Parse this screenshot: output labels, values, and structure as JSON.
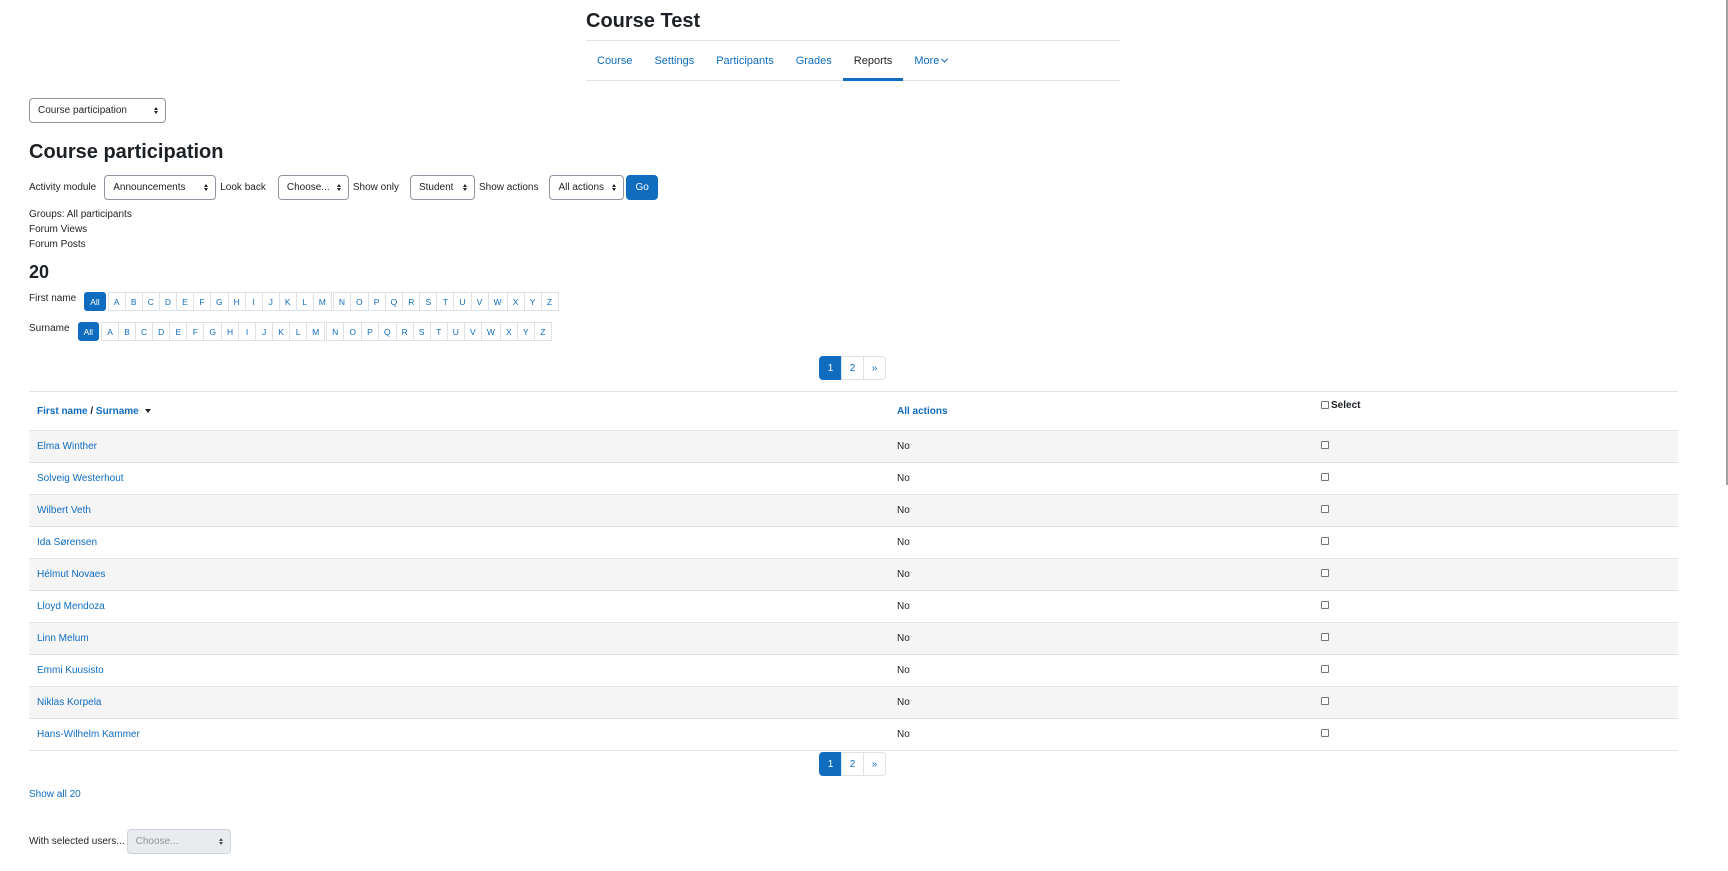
{
  "header": {
    "course_title": "Course Test",
    "nav": [
      {
        "label": "Course",
        "active": false
      },
      {
        "label": "Settings",
        "active": false
      },
      {
        "label": "Participants",
        "active": false
      },
      {
        "label": "Grades",
        "active": false
      },
      {
        "label": "Reports",
        "active": true
      },
      {
        "label": "More",
        "active": false
      }
    ]
  },
  "report_select": {
    "value": "Course participation"
  },
  "page_heading": "Course participation",
  "filters": {
    "activity_module_label": "Activity module",
    "activity_module_value": "Announcements",
    "look_back_label": "Look back",
    "look_back_value": "Choose...",
    "show_only_label": "Show only",
    "show_only_value": "Student",
    "show_actions_label": "Show actions",
    "show_actions_value": "All actions",
    "go_label": "Go"
  },
  "info": {
    "groups": "Groups: All participants",
    "forum_views": "Forum Views",
    "forum_posts": "Forum Posts"
  },
  "total_count": "20",
  "initials": {
    "first_name_label": "First name",
    "surname_label": "Surname",
    "all_label": "All",
    "group1": [
      "A",
      "B",
      "C",
      "D",
      "E",
      "F",
      "G",
      "H",
      "I",
      "J",
      "K",
      "L",
      "M"
    ],
    "group2": [
      "N",
      "O",
      "P",
      "Q",
      "R",
      "S",
      "T",
      "U",
      "V",
      "W",
      "X",
      "Y",
      "Z"
    ]
  },
  "pagination": {
    "pages": [
      "1",
      "2"
    ],
    "next": "»",
    "current": "1"
  },
  "table": {
    "col_first_name": "First name",
    "col_sep": " / ",
    "col_surname": "Surname",
    "col_actions": "All actions",
    "col_select": "Select",
    "rows": [
      {
        "name": "Elma Winther",
        "actions": "No"
      },
      {
        "name": "Solveig Westerhout",
        "actions": "No"
      },
      {
        "name": "Wilbert Veth",
        "actions": "No"
      },
      {
        "name": "Ida Sørensen",
        "actions": "No"
      },
      {
        "name": "Hélmut Novaes",
        "actions": "No"
      },
      {
        "name": "Lloyd Mendoza",
        "actions": "No"
      },
      {
        "name": "Linn Melum",
        "actions": "No"
      },
      {
        "name": "Emmi Kuusisto",
        "actions": "No"
      },
      {
        "name": "Niklas Korpela",
        "actions": "No"
      },
      {
        "name": "Hans-Wilhelm Kammer",
        "actions": "No"
      }
    ]
  },
  "show_all": "Show all 20",
  "bulk": {
    "label": "With selected users...",
    "placeholder": "Choose..."
  },
  "colors": {
    "accent": "#0f6cbf",
    "text": "#1d2125",
    "border": "#dee2e6",
    "stripe": "#f5f5f5"
  },
  "icons": [
    "chevron-down-icon",
    "select-arrows-icon",
    "sort-desc-icon",
    "checkbox-icon"
  ]
}
